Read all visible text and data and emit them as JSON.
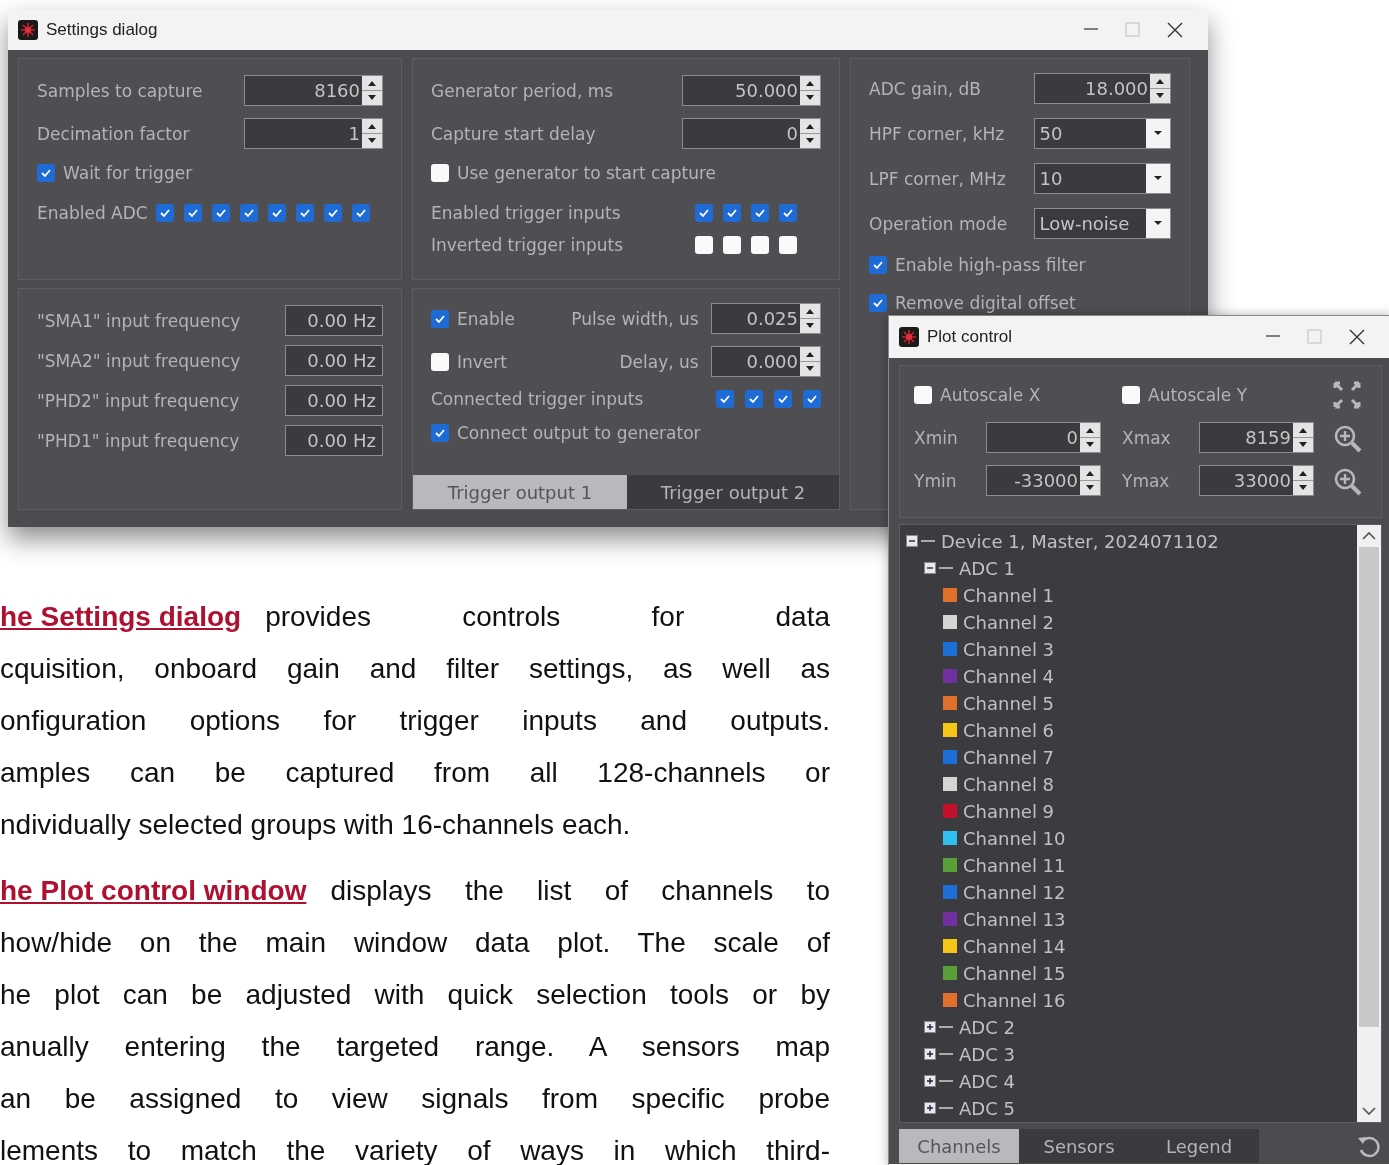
{
  "settings_dialog": {
    "title": "Settings dialog",
    "acquisition": {
      "fields": [
        {
          "label": "Samples to capture",
          "value": "8160"
        },
        {
          "label": "Decimation factor",
          "value": "1"
        }
      ],
      "wait_for_trigger": {
        "label": "Wait for trigger",
        "checked": true
      },
      "enabled_adc": {
        "label": "Enabled ADC",
        "checkboxes": [
          {
            "checked": true
          },
          {
            "checked": true
          },
          {
            "checked": true
          },
          {
            "checked": true
          },
          {
            "checked": true
          },
          {
            "checked": true
          },
          {
            "checked": true
          },
          {
            "checked": true
          }
        ]
      }
    },
    "generator": {
      "fields": [
        {
          "label": "Generator period, ms",
          "value": "50.000"
        },
        {
          "label": "Capture start delay",
          "value": "0"
        }
      ],
      "use_generator": {
        "label": "Use generator to start capture",
        "checked": false
      },
      "trigger_rows": [
        {
          "label": "Enabled trigger inputs",
          "checkboxes": [
            {
              "checked": true
            },
            {
              "checked": true
            },
            {
              "checked": true
            },
            {
              "checked": true
            }
          ]
        },
        {
          "label": "Inverted trigger inputs",
          "checkboxes": [
            {
              "checked": false
            },
            {
              "checked": false
            },
            {
              "checked": false
            },
            {
              "checked": false
            }
          ]
        }
      ]
    },
    "gain": {
      "fields": [
        {
          "kind": "spin",
          "label": "ADC gain, dB",
          "value": "18.000"
        },
        {
          "kind": "dropdown",
          "label": "HPF corner, kHz",
          "value": "50"
        },
        {
          "kind": "dropdown",
          "label": "LPF corner, MHz",
          "value": "10"
        },
        {
          "kind": "dropdown",
          "label": "Operation mode",
          "value": "Low-noise"
        }
      ],
      "checkboxes": [
        {
          "label": "Enable high-pass filter",
          "checked": true
        },
        {
          "label": "Remove digital offset",
          "checked": true
        }
      ]
    },
    "frequencies": [
      {
        "label": "\"SMA1\" input frequency",
        "value": "0.00 Hz"
      },
      {
        "label": "\"SMA2\" input frequency",
        "value": "0.00 Hz"
      },
      {
        "label": "\"PHD2\" input frequency",
        "value": "0.00 Hz"
      },
      {
        "label": "\"PHD1\" input frequency",
        "value": "0.00 Hz"
      }
    ],
    "trigger_output": {
      "enable": {
        "label": "Enable",
        "checked": true
      },
      "pulse_width": {
        "label": "Pulse width, us",
        "value": "0.025"
      },
      "invert": {
        "label": "Invert",
        "checked": false
      },
      "delay": {
        "label": "Delay, us",
        "value": "0.000"
      },
      "connected_inputs": {
        "label": "Connected trigger inputs",
        "checkboxes": [
          {
            "checked": true
          },
          {
            "checked": true
          },
          {
            "checked": true
          },
          {
            "checked": true
          }
        ]
      },
      "connect_generator": {
        "label": "Connect output to generator",
        "checked": true
      },
      "tabs": [
        {
          "label": "Trigger output 1",
          "selected": true
        },
        {
          "label": "Trigger output 2",
          "selected": false
        }
      ]
    }
  },
  "document": {
    "paragraphs": [
      {
        "link": "he Settings dialog",
        "lines": [
          "provides controls for data",
          "cquisition, onboard gain and filter settings, as well as",
          "onfiguration options for trigger inputs and outputs.",
          "amples can be captured from all 128-channels or",
          "ndividually selected groups with 16-channels each."
        ]
      },
      {
        "link": "he Plot control window",
        "lines": [
          "displays the list of channels to",
          "how/hide on the main window data plot. The scale of",
          "he plot can be adjusted with quick selection tools or by",
          "anually entering the targeted range. A sensors map",
          "an be assigned to view signals from specific probe",
          "lements to match the variety of ways in which third-"
        ]
      }
    ]
  },
  "plot_control": {
    "title": "Plot control",
    "autoscale": [
      {
        "label": "Autoscale X",
        "checked": false
      },
      {
        "label": "Autoscale Y",
        "checked": false
      }
    ],
    "ranges": [
      [
        {
          "label": "Xmin",
          "value": "0"
        },
        {
          "label": "Xmax",
          "value": "8159"
        }
      ],
      [
        {
          "label": "Ymin",
          "value": "-33000"
        },
        {
          "label": "Ymax",
          "value": "33000"
        }
      ]
    ],
    "tree": [
      {
        "label": "Device 1, Master, 2024071102",
        "expanded": true,
        "children": [
          {
            "label": "ADC 1",
            "expanded": true,
            "children": [
              {
                "label": "Channel 1",
                "color": "#e0702c"
              },
              {
                "label": "Channel 2",
                "color": "#d4d4d4"
              },
              {
                "label": "Channel 3",
                "color": "#1c6fd8"
              },
              {
                "label": "Channel 4",
                "color": "#7030a0"
              },
              {
                "label": "Channel 5",
                "color": "#e0702c"
              },
              {
                "label": "Channel 6",
                "color": "#f5c518"
              },
              {
                "label": "Channel 7",
                "color": "#1c6fd8"
              },
              {
                "label": "Channel 8",
                "color": "#d4d4d4"
              },
              {
                "label": "Channel 9",
                "color": "#c0102a"
              },
              {
                "label": "Channel 10",
                "color": "#30c0f0"
              },
              {
                "label": "Channel 11",
                "color": "#5aa03a"
              },
              {
                "label": "Channel 12",
                "color": "#1c6fd8"
              },
              {
                "label": "Channel 13",
                "color": "#7030a0"
              },
              {
                "label": "Channel 14",
                "color": "#f5c518"
              },
              {
                "label": "Channel 15",
                "color": "#5aa03a"
              },
              {
                "label": "Channel 16",
                "color": "#e0702c"
              }
            ]
          },
          {
            "label": "ADC 2",
            "expanded": false
          },
          {
            "label": "ADC 3",
            "expanded": false
          },
          {
            "label": "ADC 4",
            "expanded": false
          },
          {
            "label": "ADC 5",
            "expanded": false
          }
        ]
      }
    ],
    "tabs": [
      {
        "label": "Channels",
        "selected": true
      },
      {
        "label": "Sensors",
        "selected": false
      },
      {
        "label": "Legend",
        "selected": false
      }
    ]
  }
}
